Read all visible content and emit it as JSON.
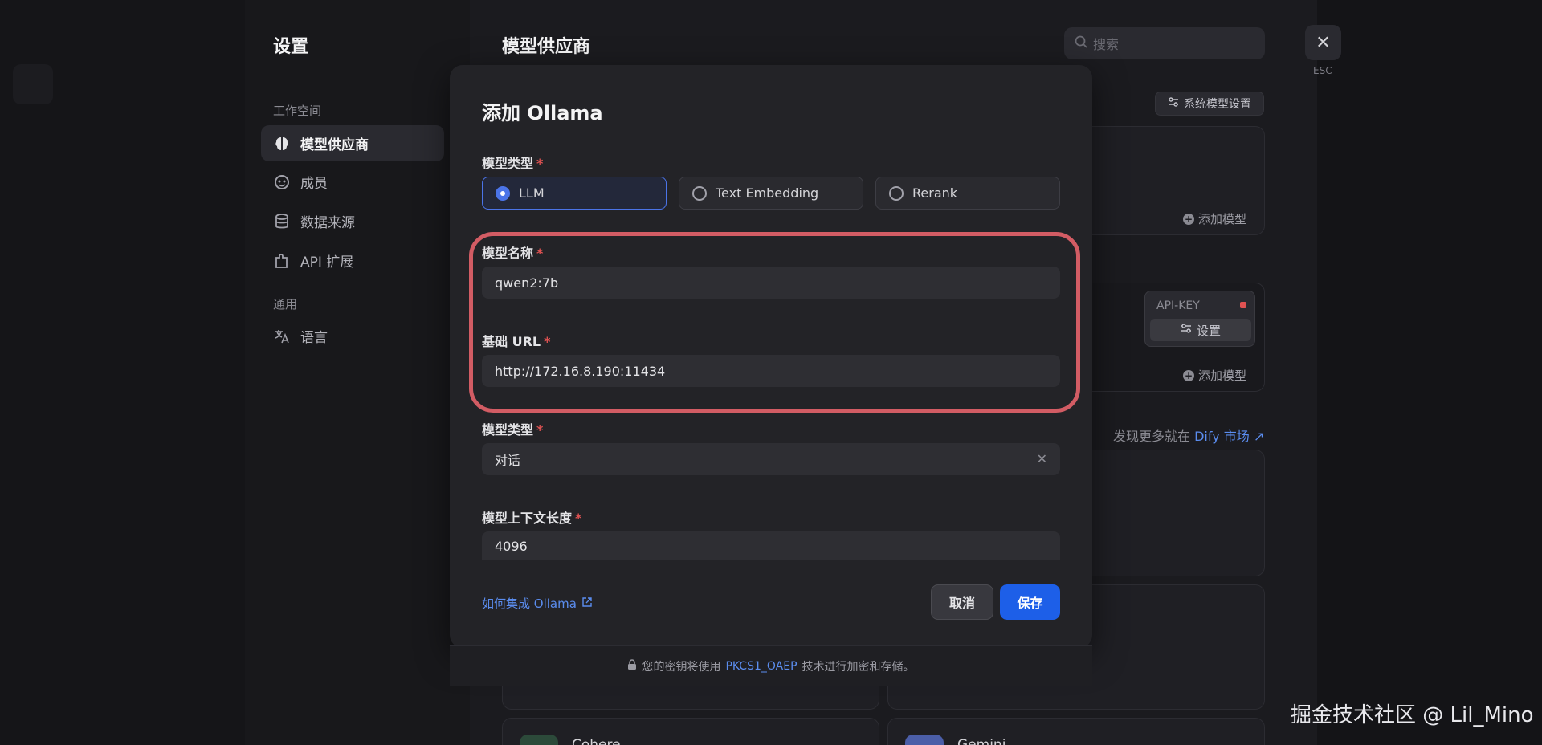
{
  "settings": {
    "title": "设置",
    "workspace_label": "工作空间",
    "general_label": "通用",
    "nav": [
      {
        "label": "模型供应商",
        "icon": "brain-icon"
      },
      {
        "label": "成员",
        "icon": "members-icon"
      },
      {
        "label": "数据来源",
        "icon": "database-icon"
      },
      {
        "label": "API 扩展",
        "icon": "puzzle-icon"
      },
      {
        "label": "语言",
        "icon": "translate-icon"
      }
    ]
  },
  "main": {
    "title": "模型供应商",
    "search_placeholder": "搜索",
    "close_label": "ESC",
    "system_model_button": "系统模型设置",
    "add_model_label": "添加模型",
    "apikey_label": "API-KEY",
    "apikey_set_label": "设置",
    "discover_prefix": "发现更多就在",
    "discover_link": "Dify 市场",
    "provider_names": [
      "Cohere",
      "Gemini"
    ]
  },
  "modal": {
    "title": "添加 Ollama",
    "model_type_label": "模型类型",
    "model_type_options": [
      "LLM",
      "Text Embedding",
      "Rerank"
    ],
    "model_type_selected": "LLM",
    "model_name_label": "模型名称",
    "model_name_value": "qwen2:7b",
    "base_url_label": "基础 URL",
    "base_url_value": "http://172.16.8.190:11434",
    "completion_type_label": "模型类型",
    "completion_type_value": "对话",
    "context_length_label": "模型上下文长度",
    "context_length_value": "4096",
    "help_link": "如何集成 Ollama",
    "cancel_label": "取消",
    "save_label": "保存",
    "footer_prefix": "您的密钥将使用",
    "footer_link": "PKCS1_OAEP",
    "footer_suffix": "技术进行加密和存储。"
  },
  "watermark": "掘金技术社区 @ Lil_Mino",
  "colors": {
    "accent": "#1d5fe8",
    "link": "#5b8def",
    "required": "#e05252",
    "highlight_ring": "#d25c64"
  }
}
